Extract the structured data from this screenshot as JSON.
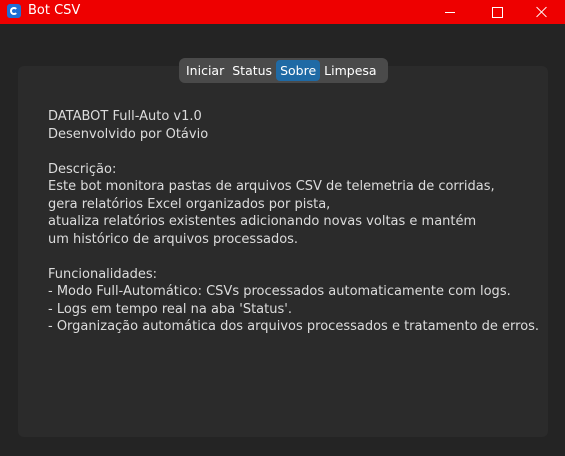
{
  "window": {
    "title": "Bot CSV",
    "icon": "app-icon",
    "titlebar_color": "#ee0000"
  },
  "tabs": [
    {
      "label": "Iniciar",
      "active": false
    },
    {
      "label": "Status",
      "active": false
    },
    {
      "label": "Sobre",
      "active": true
    },
    {
      "label": "Limpesa",
      "active": false
    }
  ],
  "about": {
    "header_lines": [
      "DATABOT Full-Auto v1.0",
      "Desenvolvido por Otávio"
    ],
    "description_title": "Descrição:",
    "description_lines": [
      "Este bot monitora pastas de arquivos CSV de telemetria de corridas,",
      "gera relatórios Excel organizados por pista,",
      "atualiza relatórios existentes adicionando novas voltas e mantém",
      "um histórico de arquivos processados."
    ],
    "features_title": "Funcionalidades:",
    "features_lines": [
      "- Modo Full-Automático: CSVs processados automaticamente com logs.",
      "- Logs em tempo real na aba 'Status'.",
      "- Organização automática dos arquivos processados e tratamento de erros."
    ]
  },
  "colors": {
    "accent": "#1f6aa5",
    "background": "#242424",
    "panel": "#2b2b2b"
  }
}
